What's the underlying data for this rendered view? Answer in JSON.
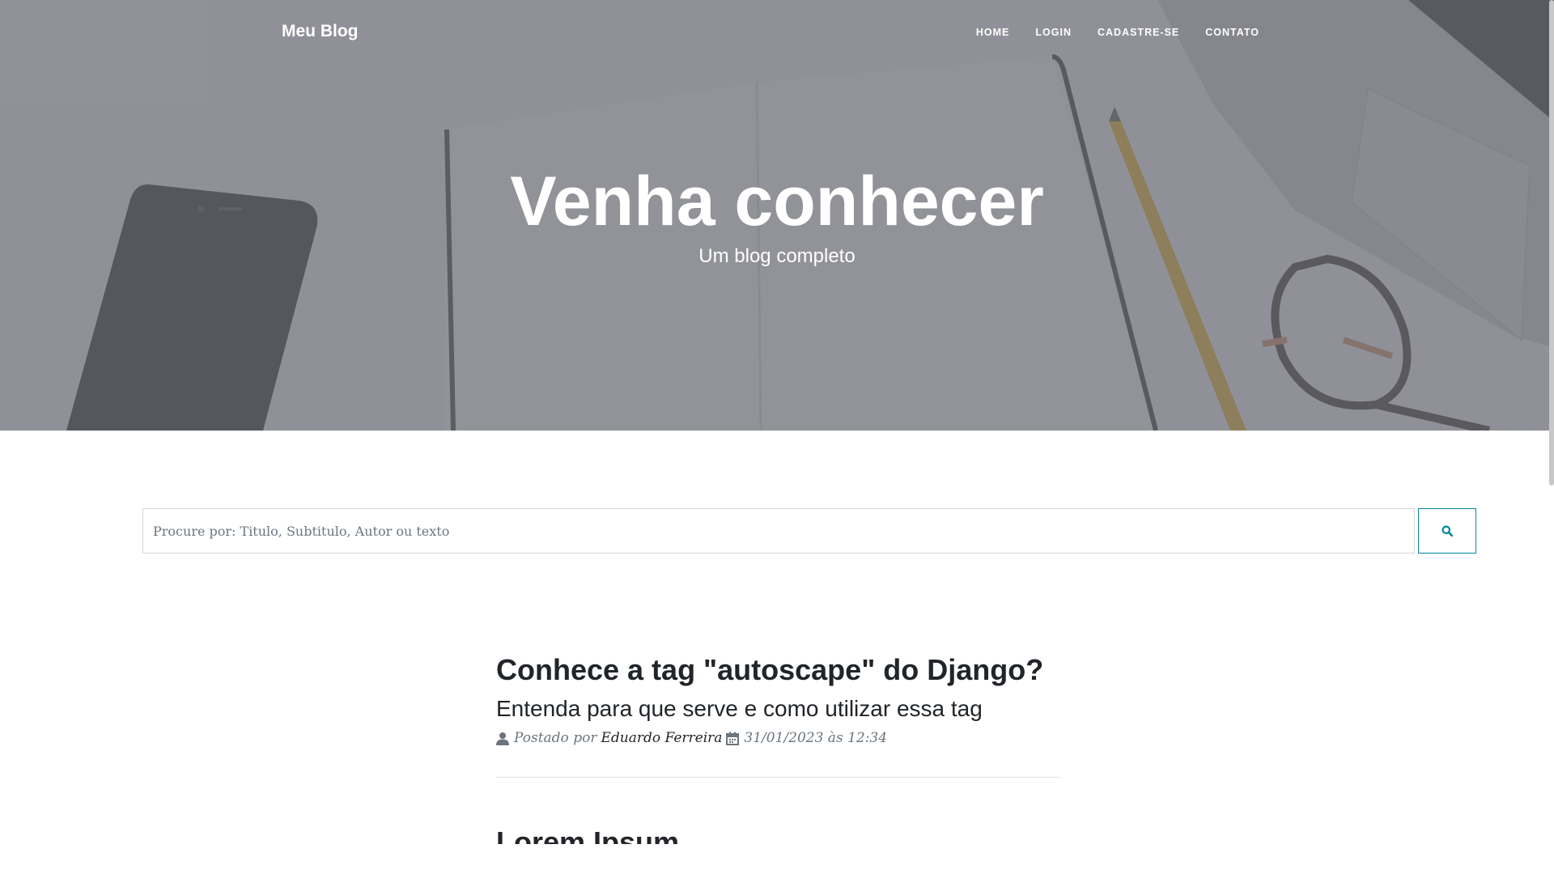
{
  "navbar": {
    "brand": "Meu Blog",
    "links": [
      "HOME",
      "LOGIN",
      "CADASTRE-SE",
      "CONTATO"
    ]
  },
  "hero": {
    "title": "Venha conhecer",
    "subtitle": "Um blog completo"
  },
  "search": {
    "placeholder": "Procure por: Titulo, Subtitulo, Autor ou texto",
    "button_icon": "search-icon"
  },
  "posts": [
    {
      "title": "Conhece a tag \"autoscape\" do Django?",
      "subtitle": "Entenda para que serve e como utilizar essa tag",
      "posted_by_label": "Postado por",
      "author": "Eduardo Ferreira",
      "date": "31/01/2023 às 12:34"
    },
    {
      "title": "Lorem Ipsum"
    }
  ],
  "colors": {
    "accent": "#0085a1",
    "text": "#212529",
    "muted": "#6c757d"
  }
}
